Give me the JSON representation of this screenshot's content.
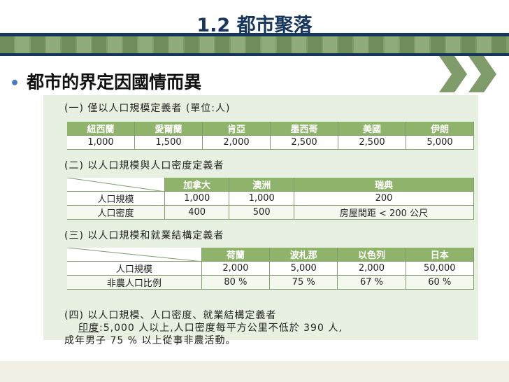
{
  "title": "1.2 都市聚落",
  "bullet": "都市的界定因國情而異",
  "section1": {
    "heading": "(一) 僅以人口規模定義者 (單位:人)",
    "headers": [
      "紐西蘭",
      "愛爾蘭",
      "肯亞",
      "墨西哥",
      "美國",
      "伊朗"
    ],
    "values": [
      "1,000",
      "1,500",
      "2,000",
      "2,500",
      "2,500",
      "5,000"
    ]
  },
  "section2": {
    "heading": "(二) 以人口規模與人口密度定義者",
    "headers": [
      "加拿大",
      "澳洲",
      "瑞典"
    ],
    "rows": [
      {
        "label": "人口規模",
        "values": [
          "1,000",
          "1,000",
          "200"
        ]
      },
      {
        "label": "人口密度",
        "values": [
          "400",
          "500",
          "房屋間距 < 200 公尺"
        ]
      }
    ]
  },
  "section3": {
    "heading": "(三) 以人口規模和就業結構定義者",
    "headers": [
      "荷蘭",
      "波札那",
      "以色列",
      "日本"
    ],
    "rows": [
      {
        "label": "人口規模",
        "values": [
          "2,000",
          "5,000",
          "2,000",
          "50,000"
        ]
      },
      {
        "label": "非農人口比例",
        "values": [
          "80 %",
          "75 %",
          "67 %",
          "60 %"
        ]
      }
    ]
  },
  "section4": {
    "heading": "(四) 以人口規模、人口密度、就業結構定義者",
    "country": "印度",
    "line1": ":5,000 人以上,人口密度每平方公里不低於 390 人,",
    "line2": "成年男子 75 % 以上從事非農活動。"
  }
}
